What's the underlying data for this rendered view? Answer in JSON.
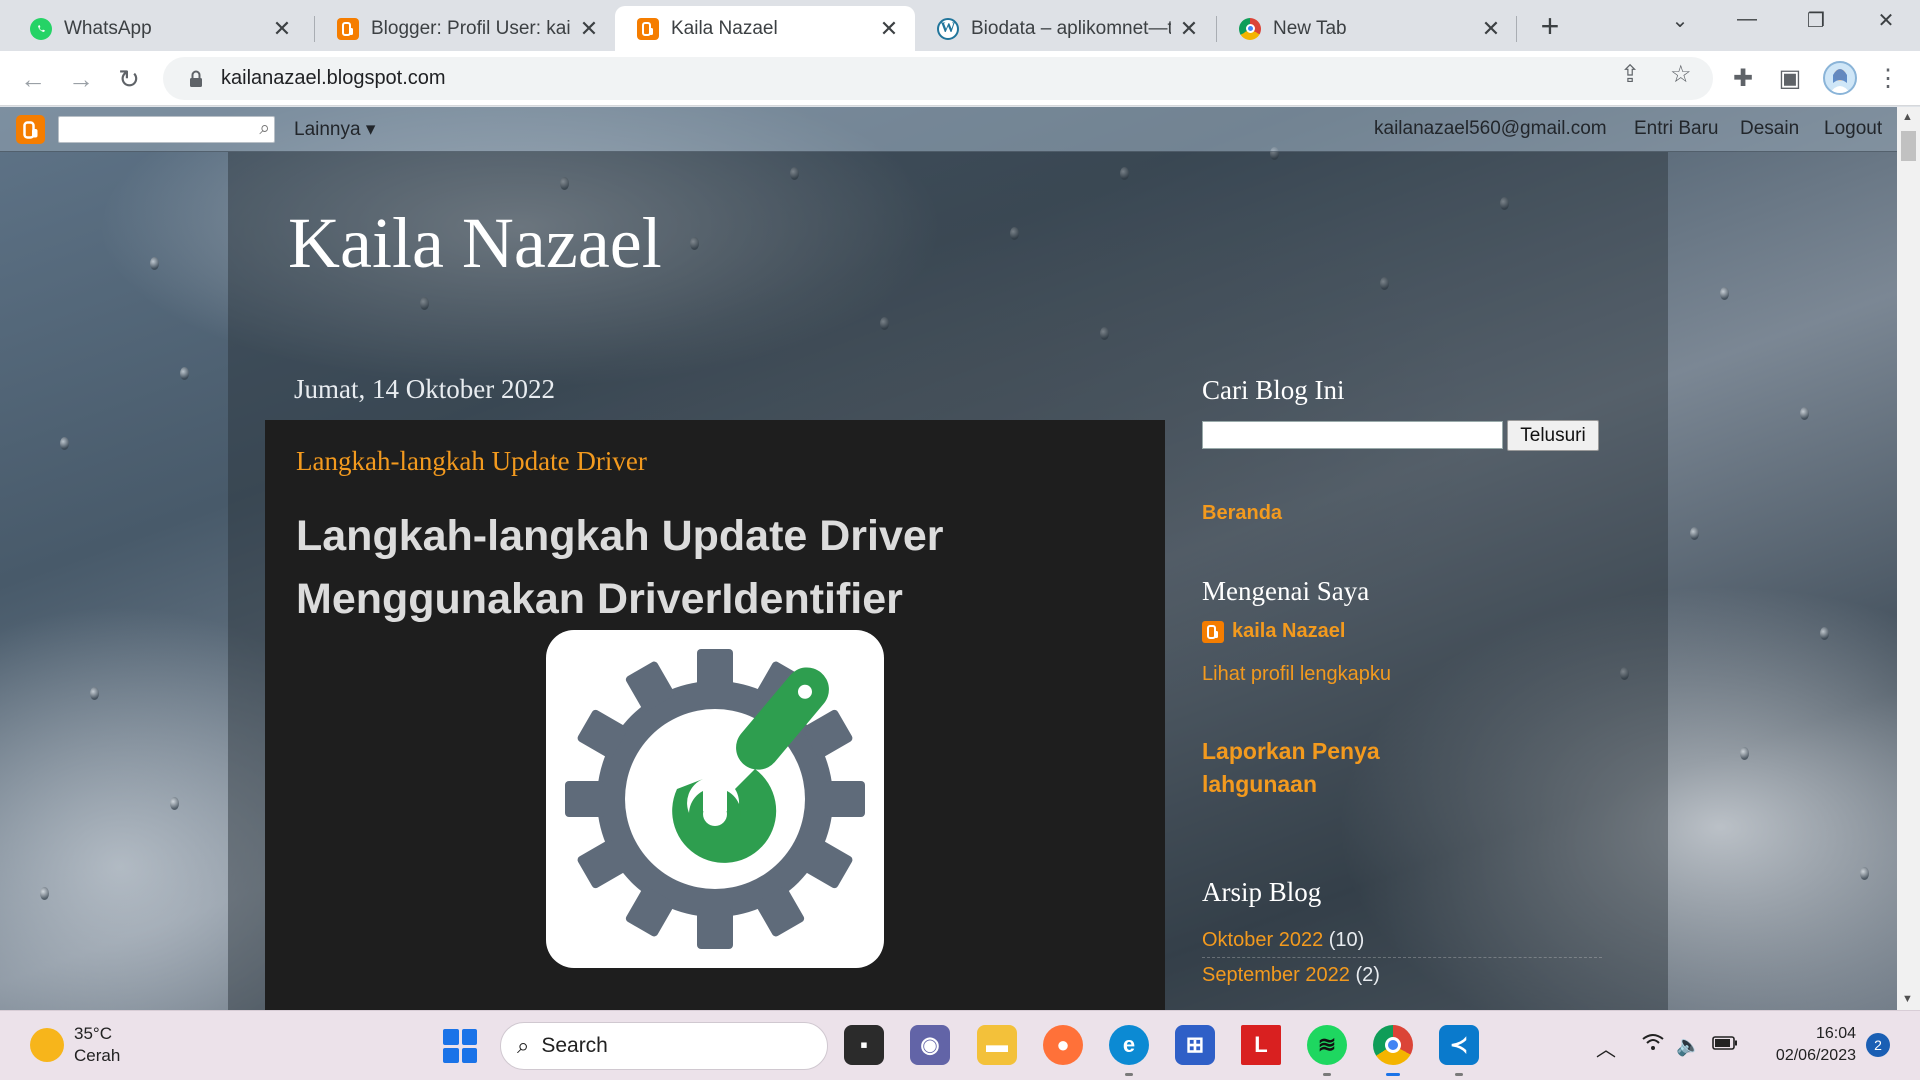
{
  "browser": {
    "tabs": [
      {
        "label": "WhatsApp",
        "icon": "whatsapp-icon",
        "active": false
      },
      {
        "label": "Blogger: Profil User: kaila",
        "icon": "blogger-icon",
        "active": false
      },
      {
        "label": "Kaila Nazael",
        "icon": "blogger-icon",
        "active": true
      },
      {
        "label": "Biodata – aplikomnet—ti",
        "icon": "wordpress-icon",
        "active": false
      },
      {
        "label": "New Tab",
        "icon": "chrome-icon",
        "active": false
      }
    ],
    "url": "kailanazael.blogspot.com"
  },
  "blogger_bar": {
    "more_label": "Lainnya",
    "email": "kailanazael560@gmail.com",
    "new_post": "Entri Baru",
    "design": "Desain",
    "logout": "Logout"
  },
  "blog": {
    "title": "Kaila Nazael",
    "post_date": "Jumat, 14 Oktober 2022",
    "post_title": "Langkah-langkah Update Driver",
    "post_heading": "Langkah-langkah Update Driver Menggunakan DriverIdentifier"
  },
  "sidebar": {
    "search_heading": "Cari Blog Ini",
    "search_button": "Telusuri",
    "home_link": "Beranda",
    "about_heading": "Mengenai Saya",
    "profile_name": "kaila Nazael",
    "profile_link": "Lihat profil lengkapku",
    "report_link": "Laporkan Penyalahgunaan",
    "archive_heading": "Arsip Blog",
    "archive": [
      {
        "label": "Oktober 2022",
        "count": "(10)"
      },
      {
        "label": "September 2022",
        "count": "(2)"
      }
    ]
  },
  "taskbar": {
    "temperature": "35°C",
    "condition": "Cerah",
    "search_label": "Search",
    "time": "16:04",
    "date": "02/06/2023",
    "notifications": "2"
  },
  "colors": {
    "accent": "#f39a1e",
    "blogger_orange": "#f57d00",
    "post_bg": "#1e1e1e"
  }
}
